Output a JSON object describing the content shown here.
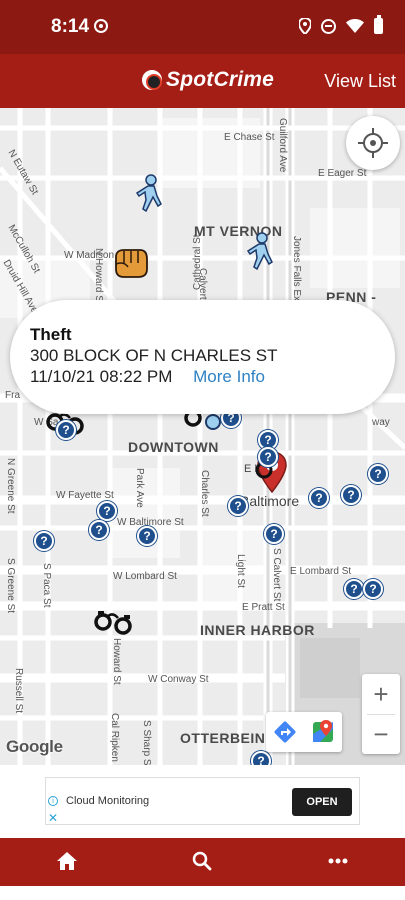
{
  "status_bar": {
    "time": "8:14"
  },
  "app_bar": {
    "logo_text": "SpotCrime",
    "view_list_label": "View List"
  },
  "map": {
    "areas": [
      "MT VERNON",
      "PENN -",
      "DOWNTOWN",
      "INNER HARBOR",
      "OTTERBEIN"
    ],
    "streets": {
      "chase": "E Chase St",
      "eager": "E Eager St",
      "guilford": "Guilford Ave",
      "eutaw": "N Eutaw St",
      "mcculloh": "McCulloh St",
      "druid": "Druid Hill Ave",
      "madison": "W Madison St",
      "howard": "N Howard St",
      "cathedral": "Cathedral St",
      "calvert_n": "Calvert St",
      "jones": "Jones Falls Expy",
      "fayette": "W Fayette St",
      "baltimore_w": "W Baltimore St",
      "lombard_w": "W Lombard St",
      "lombard_e": "E Lombard St",
      "pratt": "E Pratt St",
      "conway": "W Conway St",
      "park": "Park Ave",
      "charles": "Charles St",
      "light": "Light St",
      "calvert_s": "S Calvert St",
      "greene_n": "N Greene St",
      "greene_s": "S Greene St",
      "paca": "S Paca St",
      "russell": "Russell St",
      "howard_s": "Howard St",
      "ripken": "Cal Ripken W",
      "sharp": "S Sharp St",
      "baltimore_city": "Baltimore",
      "fra": "Fra",
      "ws": "W Sa",
      "way": "way",
      "el": "E L"
    },
    "attribution": "Google"
  },
  "info_card": {
    "type": "Theft",
    "address": "300 BLOCK OF N CHARLES ST",
    "datetime": "11/10/21 08:22 PM",
    "more_info_label": "More Info"
  },
  "markers": {
    "unknown_symbol": "?"
  },
  "zoom": {
    "in_label": "+",
    "out_label": "−"
  },
  "ad": {
    "text": "Cloud Monitoring",
    "cta": "OPEN",
    "info_symbol": "i",
    "close_symbol": "✕"
  },
  "colors": {
    "header": "#a41e16",
    "status": "#8c1a12",
    "marker": "#1f4f8c",
    "link": "#2f82c4"
  },
  "icons": [
    "cast-icon",
    "location-icon",
    "dnd-icon",
    "wifi-icon",
    "battery-icon",
    "home-icon",
    "search-icon",
    "more-icon"
  ]
}
